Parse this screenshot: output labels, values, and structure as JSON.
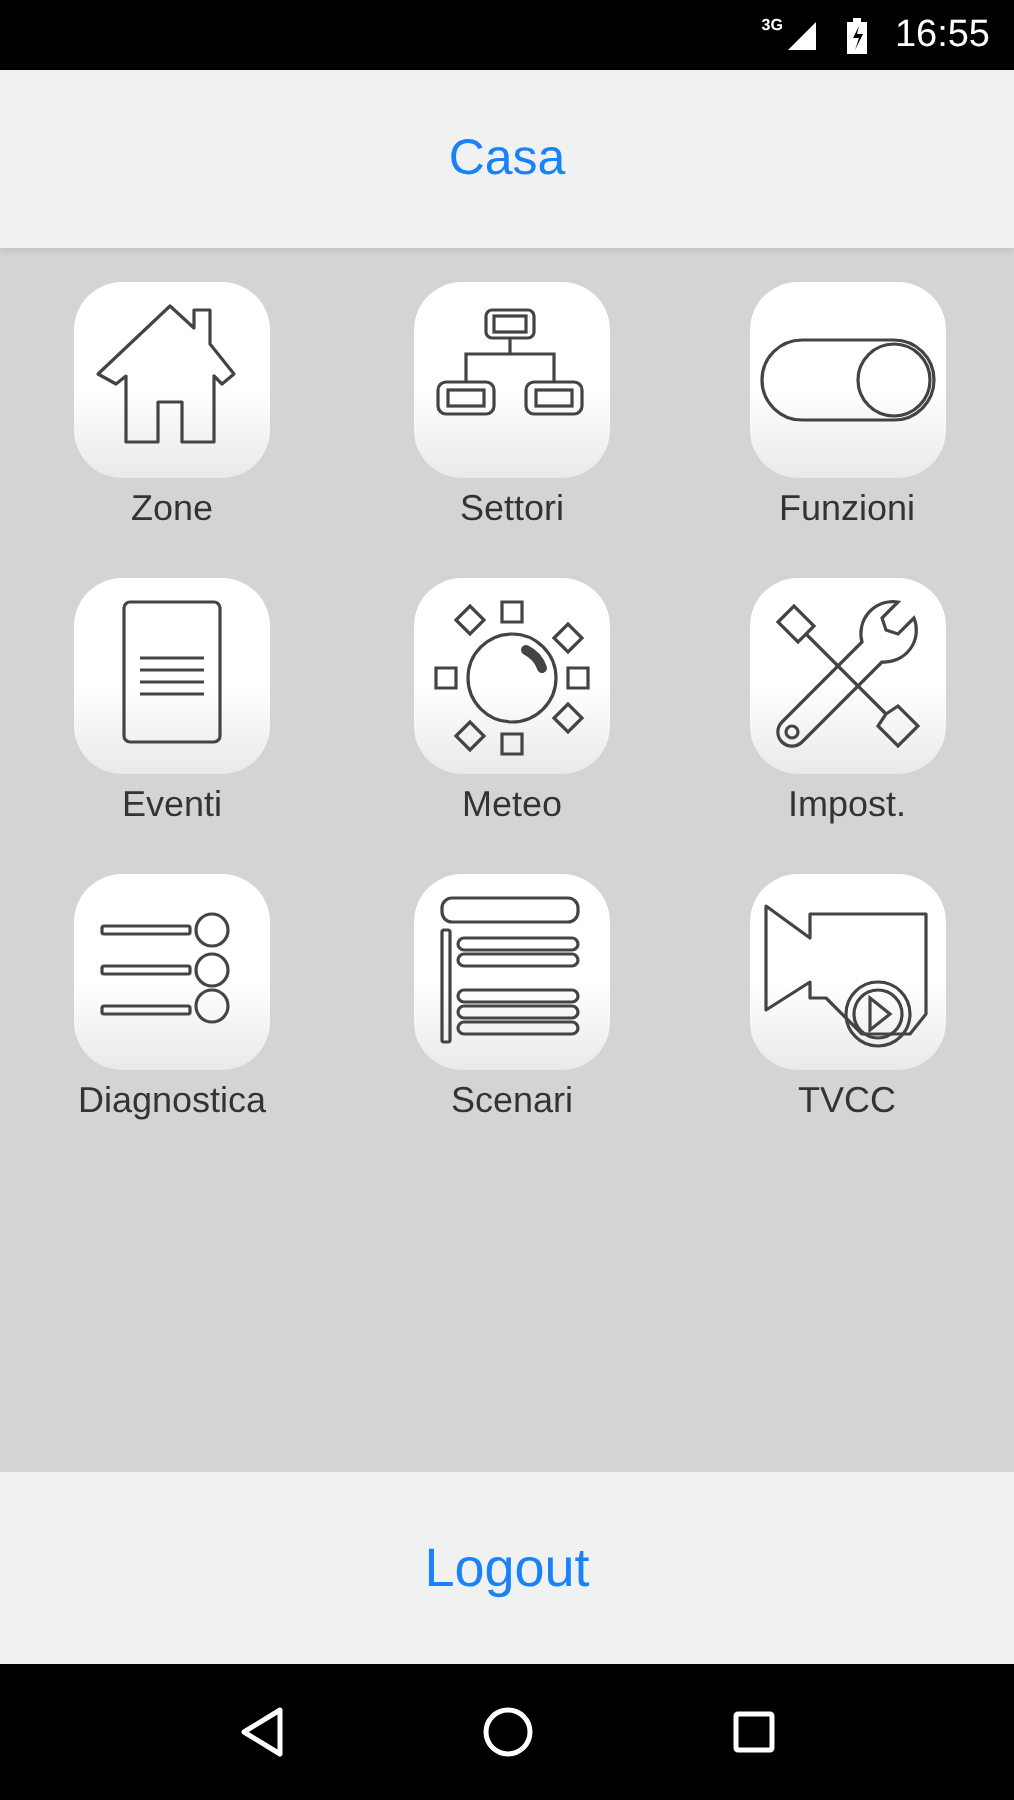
{
  "status_bar": {
    "network": "3G",
    "time": "16:55"
  },
  "header": {
    "title": "Casa"
  },
  "tiles": [
    {
      "kind": "house",
      "label": "Zone"
    },
    {
      "kind": "network",
      "label": "Settori"
    },
    {
      "kind": "toggle",
      "label": "Funzioni"
    },
    {
      "kind": "document",
      "label": "Eventi"
    },
    {
      "kind": "sun",
      "label": "Meteo"
    },
    {
      "kind": "tools",
      "label": "Impost."
    },
    {
      "kind": "list",
      "label": "Diagnostica"
    },
    {
      "kind": "scenes",
      "label": "Scenari"
    },
    {
      "kind": "camera",
      "label": "TVCC"
    }
  ],
  "footer": {
    "button": "Logout"
  }
}
